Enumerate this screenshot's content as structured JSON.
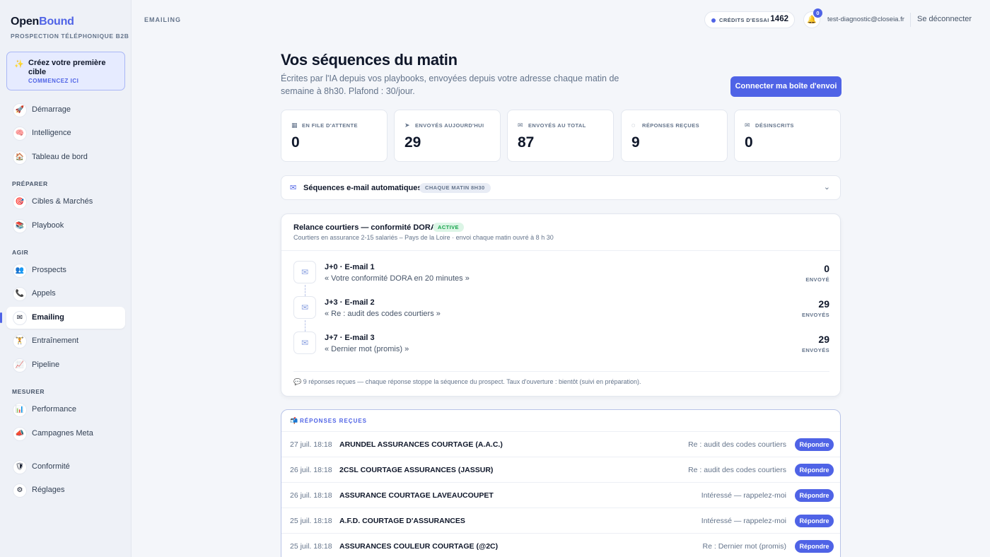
{
  "brand": {
    "part1": "Open",
    "part2": "Bound",
    "subtitle": "PROSPECTION TÉLÉPHONIQUE B2B"
  },
  "cta": {
    "icon": "sparkles-icon",
    "title": "Créez votre première cible",
    "link": "COMMENCEZ ICI"
  },
  "nav": {
    "top": [
      {
        "label": "Démarrage",
        "icon": "🚀",
        "icon_name": "rocket-icon"
      },
      {
        "label": "Intelligence",
        "icon": "🧠",
        "icon_name": "brain-icon"
      },
      {
        "label": "Tableau de bord",
        "icon": "🏠",
        "icon_name": "home-icon"
      }
    ],
    "sections": [
      {
        "label": "PRÉPARER",
        "items": [
          {
            "label": "Cibles & Marchés",
            "icon": "🎯",
            "icon_name": "target-icon"
          },
          {
            "label": "Playbook",
            "icon": "📚",
            "icon_name": "books-icon"
          }
        ]
      },
      {
        "label": "AGIR",
        "items": [
          {
            "label": "Prospects",
            "icon": "👥",
            "icon_name": "users-icon"
          },
          {
            "label": "Appels",
            "icon": "📞",
            "icon_name": "phone-icon"
          },
          {
            "label": "Emailing",
            "icon": "✉",
            "icon_name": "envelope-icon",
            "active": true
          },
          {
            "label": "Entraînement",
            "icon": "🏋",
            "icon_name": "training-icon"
          },
          {
            "label": "Pipeline",
            "icon": "📈",
            "icon_name": "chart-up-icon"
          }
        ]
      },
      {
        "label": "MESURER",
        "items": [
          {
            "label": "Performance",
            "icon": "📊",
            "icon_name": "bar-chart-icon"
          },
          {
            "label": "Campagnes Meta",
            "icon": "📣",
            "icon_name": "megaphone-icon"
          }
        ]
      }
    ],
    "bottom": [
      {
        "label": "Conformité",
        "icon": "🛡",
        "icon_name": "shield-icon"
      },
      {
        "label": "Réglages",
        "icon": "⚙",
        "icon_name": "gear-icon"
      }
    ]
  },
  "topbar": {
    "breadcrumb": "EMAILING",
    "credits_label": "CRÉDITS D'ESSAI",
    "credits_value": "1462",
    "notifications": "0",
    "user_email": "test-diagnostic@closeia.fr",
    "logout": "Se déconnecter"
  },
  "header": {
    "title": "Vos séquences du matin",
    "subtitle": "Écrites par l'IA depuis vos playbooks, envoyées depuis votre adresse chaque matin de semaine à 8h30. Plafond : 30/jour.",
    "connect_button": "Connecter ma boîte d'envoi"
  },
  "stats": [
    {
      "label": "EN FILE D'ATTENTE",
      "value": "0",
      "icon": "calendar-icon"
    },
    {
      "label": "ENVOYÉS AUJOURD'HUI",
      "value": "29",
      "icon": "send-icon"
    },
    {
      "label": "ENVOYÉS AU TOTAL",
      "value": "87",
      "icon": "mail-icon"
    },
    {
      "label": "RÉPONSES REÇUES",
      "value": "9",
      "icon": "chat-icon"
    },
    {
      "label": "DÉSINSCRITS",
      "value": "0",
      "icon": "mail-off-icon"
    }
  ],
  "sequences_bar": {
    "title": "Séquences e-mail automatiques",
    "badge": "CHAQUE MATIN 8H30"
  },
  "sequence": {
    "title": "Relance courtiers — conformité DORA",
    "status": "ACTIVE",
    "description": "Courtiers en assurance 2-15 salariés – Pays de la Loire · envoi chaque matin ouvré à 8 h 30",
    "steps": [
      {
        "name": "J+0 · E-mail 1",
        "subject": "« Votre conformité DORA en 20 minutes »",
        "count": "0",
        "count_label": "ENVOYÉ"
      },
      {
        "name": "J+3 · E-mail 2",
        "subject": "« Re : audit des codes courtiers »",
        "count": "29",
        "count_label": "ENVOYÉS"
      },
      {
        "name": "J+7 · E-mail 3",
        "subject": "« Dernier mot (promis) »",
        "count": "29",
        "count_label": "ENVOYÉS"
      }
    ],
    "footer": "💬 9 réponses reçues — chaque réponse stoppe la séquence du prospect. Taux d'ouverture : bientôt (suivi en préparation)."
  },
  "replies": {
    "title": "RÉPONSES REÇUES",
    "reply_label": "Répondre",
    "rows": [
      {
        "date": "27 juil. 18:18",
        "company": "ARUNDEL ASSURANCES COURTAGE (A.A.C.)",
        "subject": "Re : audit des codes courtiers"
      },
      {
        "date": "26 juil. 18:18",
        "company": "2CSL COURTAGE ASSURANCES (JASSUR)",
        "subject": "Re : audit des codes courtiers"
      },
      {
        "date": "26 juil. 18:18",
        "company": "ASSURANCE COURTAGE LAVEAUCOUPET",
        "subject": "Intéressé — rappelez-moi"
      },
      {
        "date": "25 juil. 18:18",
        "company": "A.F.D. COURTAGE D'ASSURANCES",
        "subject": "Intéressé — rappelez-moi"
      },
      {
        "date": "25 juil. 18:18",
        "company": "ASSURANCES COULEUR COURTAGE (@2C)",
        "subject": "Re : Dernier mot (promis)"
      }
    ]
  },
  "colors": {
    "accent": "#4f63e6",
    "success": "#16a34a",
    "background": "#f4f6fa"
  }
}
